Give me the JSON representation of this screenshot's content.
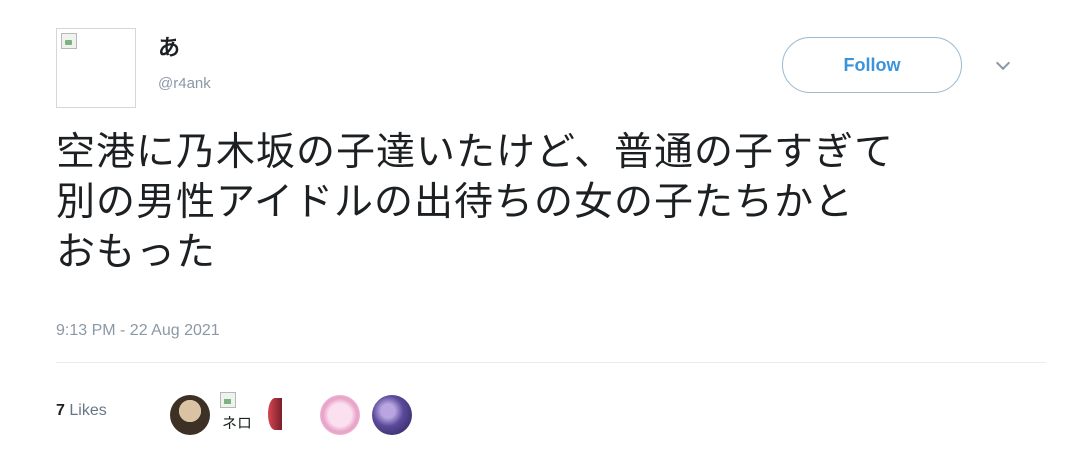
{
  "tweet": {
    "display_name": "あ",
    "handle": "@r4ank",
    "follow_label": "Follow",
    "text": "空港に乃木坂の子達いたけど、普通の子すぎて\n別の男性アイドルの出待ちの女の子たちかと\nおもった",
    "timestamp": "9:13 PM - 22 Aug 2021"
  },
  "likes": {
    "count": "7",
    "label": "Likes",
    "liker_alt_text": "ネロ"
  },
  "colors": {
    "accent": "#3b94d9",
    "muted_text": "#8b98a5",
    "text": "#1c2022"
  }
}
